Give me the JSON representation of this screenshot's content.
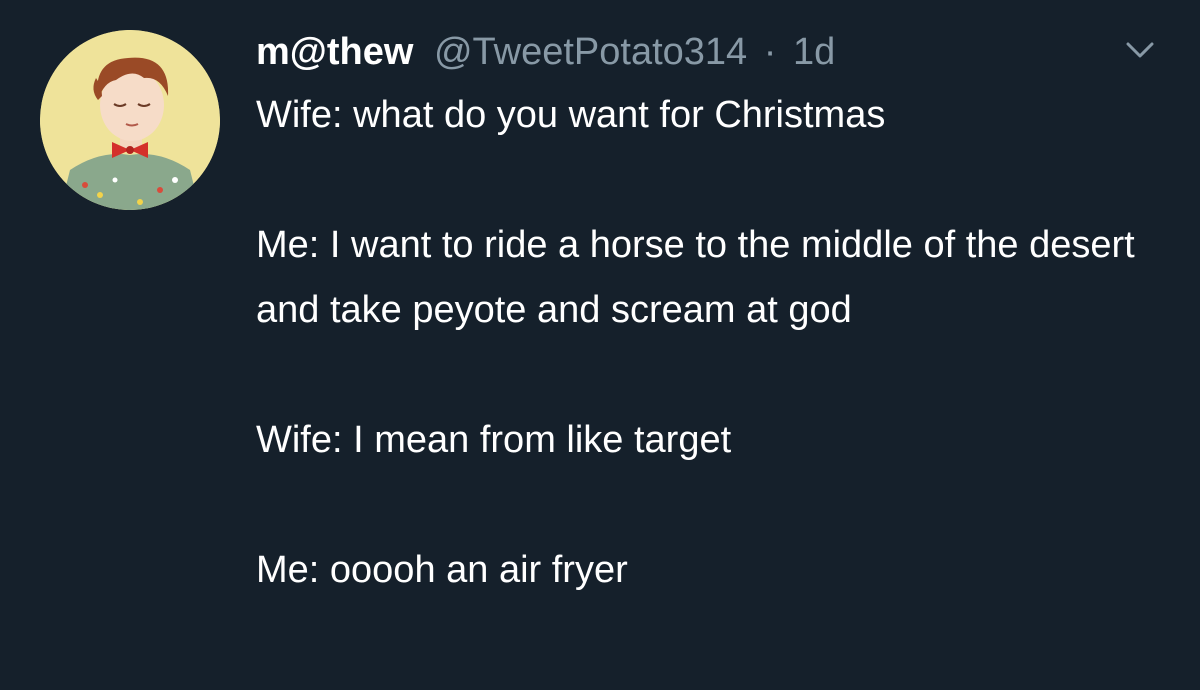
{
  "tweet": {
    "display_name": "m@thew",
    "handle": "@TweetPotato314",
    "separator": "·",
    "time": "1d",
    "icons": {
      "avatar": "avatar",
      "caret": "chevron-down-icon"
    },
    "paragraphs": [
      "Wife: what do you want for Christmas",
      "Me: I want to ride a horse to the middle of the desert and take peyote and scream at god",
      "Wife: I mean from like target",
      "Me: ooooh an air fryer"
    ]
  },
  "colors": {
    "background": "#15202b",
    "text": "#ffffff",
    "muted": "#8899a6"
  }
}
